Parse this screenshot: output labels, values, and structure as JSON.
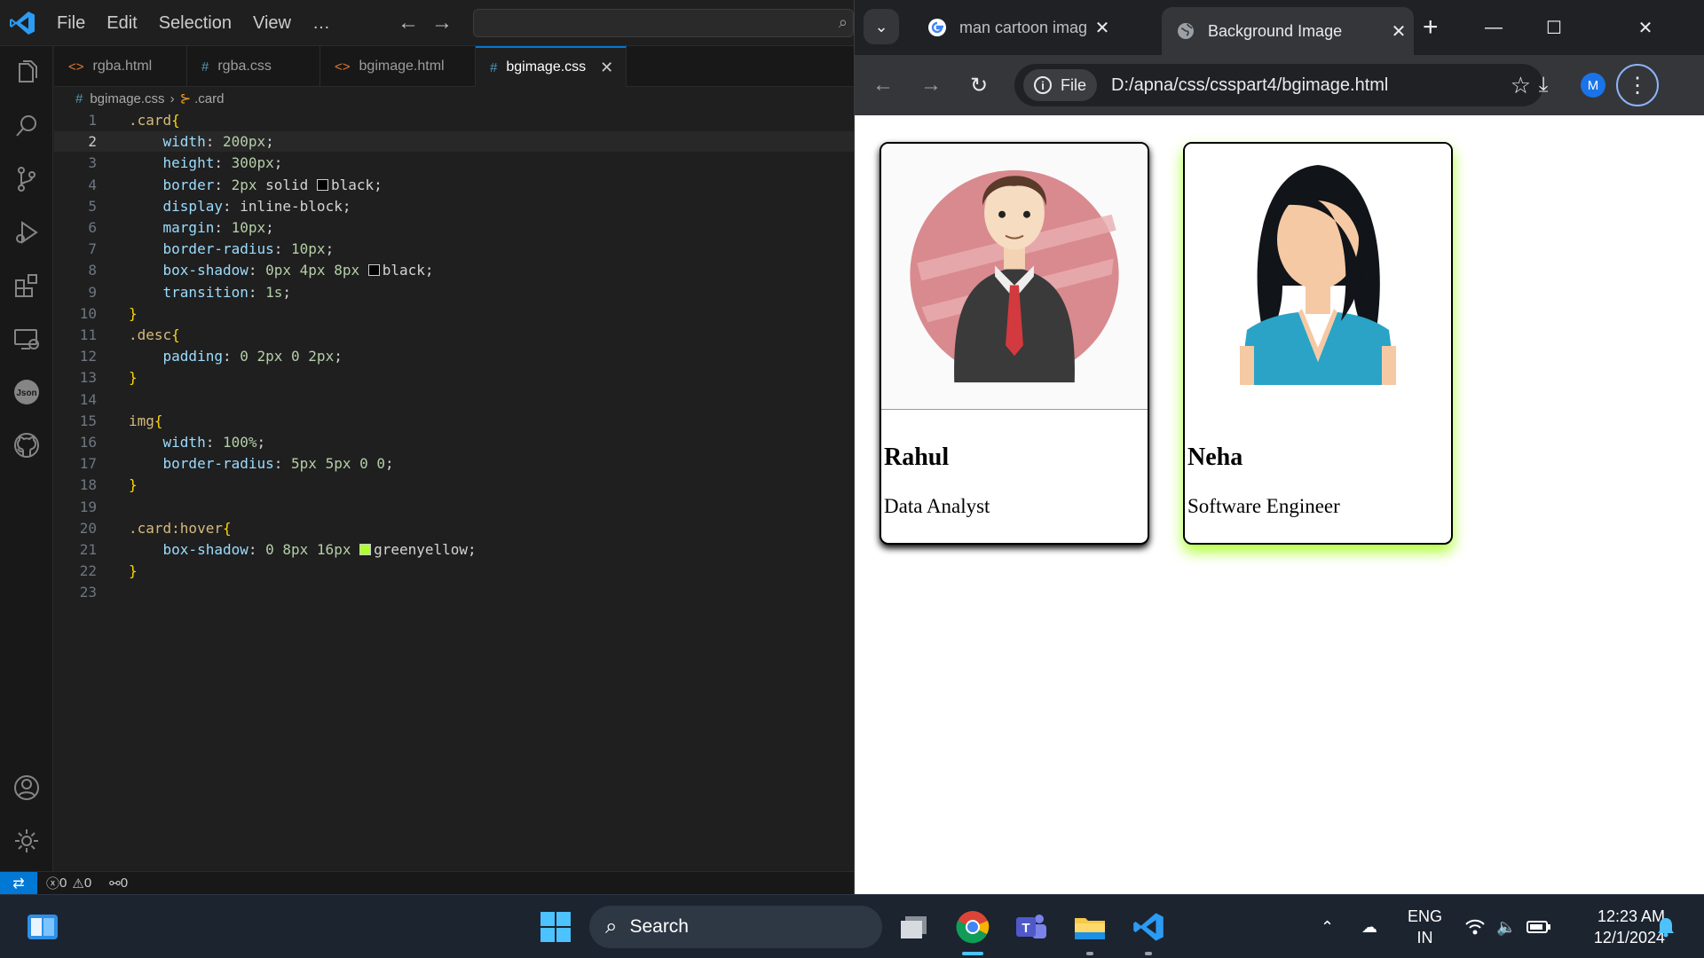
{
  "vscode": {
    "menu": [
      "File",
      "Edit",
      "Selection",
      "View",
      "…"
    ],
    "tabs": [
      {
        "label": "rgba.html",
        "icon": "<>",
        "kind": "html"
      },
      {
        "label": "rgba.css",
        "icon": "#",
        "kind": "css"
      },
      {
        "label": "bgimage.html",
        "icon": "<>",
        "kind": "html"
      },
      {
        "label": "bgimage.css",
        "icon": "#",
        "kind": "css",
        "active": true
      }
    ],
    "breadcrumb": {
      "file": "bgimage.css",
      "symbol": ".card"
    },
    "current_line": 2,
    "lines": [
      {
        "n": "1",
        "tokens": [
          [
            "sel",
            ".card"
          ],
          [
            "brace",
            "{"
          ]
        ]
      },
      {
        "n": "2",
        "tokens": [
          [
            "kw",
            "    "
          ],
          [
            "prop",
            "width"
          ],
          [
            "kw",
            ": "
          ],
          [
            "num",
            "200px"
          ],
          [
            "kw",
            ";"
          ]
        ]
      },
      {
        "n": "3",
        "tokens": [
          [
            "kw",
            "    "
          ],
          [
            "prop",
            "height"
          ],
          [
            "kw",
            ": "
          ],
          [
            "num",
            "300px"
          ],
          [
            "kw",
            ";"
          ]
        ]
      },
      {
        "n": "4",
        "tokens": [
          [
            "kw",
            "    "
          ],
          [
            "prop",
            "border"
          ],
          [
            "kw",
            ": "
          ],
          [
            "num",
            "2px"
          ],
          [
            "kw",
            " solid "
          ],
          [
            "swatch",
            "#000000"
          ],
          [
            "kw",
            "black;"
          ]
        ]
      },
      {
        "n": "5",
        "tokens": [
          [
            "kw",
            "    "
          ],
          [
            "prop",
            "display"
          ],
          [
            "kw",
            ": inline-block;"
          ]
        ]
      },
      {
        "n": "6",
        "tokens": [
          [
            "kw",
            "    "
          ],
          [
            "prop",
            "margin"
          ],
          [
            "kw",
            ": "
          ],
          [
            "num",
            "10px"
          ],
          [
            "kw",
            ";"
          ]
        ]
      },
      {
        "n": "7",
        "tokens": [
          [
            "kw",
            "    "
          ],
          [
            "prop",
            "border-radius"
          ],
          [
            "kw",
            ": "
          ],
          [
            "num",
            "10px"
          ],
          [
            "kw",
            ";"
          ]
        ]
      },
      {
        "n": "8",
        "tokens": [
          [
            "kw",
            "    "
          ],
          [
            "prop",
            "box-shadow"
          ],
          [
            "kw",
            ": "
          ],
          [
            "num",
            "0px 4px 8px"
          ],
          [
            "kw",
            " "
          ],
          [
            "swatch",
            "#000000"
          ],
          [
            "kw",
            "black;"
          ]
        ]
      },
      {
        "n": "9",
        "tokens": [
          [
            "kw",
            "    "
          ],
          [
            "prop",
            "transition"
          ],
          [
            "kw",
            ": "
          ],
          [
            "num",
            "1s"
          ],
          [
            "kw",
            ";"
          ]
        ]
      },
      {
        "n": "10",
        "tokens": [
          [
            "brace",
            "}"
          ]
        ]
      },
      {
        "n": "11",
        "tokens": [
          [
            "sel",
            ".desc"
          ],
          [
            "brace",
            "{"
          ]
        ]
      },
      {
        "n": "12",
        "tokens": [
          [
            "kw",
            "    "
          ],
          [
            "prop",
            "padding"
          ],
          [
            "kw",
            ": "
          ],
          [
            "num",
            "0 2px 0 2px"
          ],
          [
            "kw",
            ";"
          ]
        ]
      },
      {
        "n": "13",
        "tokens": [
          [
            "brace",
            "}"
          ]
        ]
      },
      {
        "n": "14",
        "tokens": []
      },
      {
        "n": "15",
        "tokens": [
          [
            "sel",
            "img"
          ],
          [
            "brace",
            "{"
          ]
        ]
      },
      {
        "n": "16",
        "tokens": [
          [
            "kw",
            "    "
          ],
          [
            "prop",
            "width"
          ],
          [
            "kw",
            ": "
          ],
          [
            "num",
            "100%"
          ],
          [
            "kw",
            ";"
          ]
        ]
      },
      {
        "n": "17",
        "tokens": [
          [
            "kw",
            "    "
          ],
          [
            "prop",
            "border-radius"
          ],
          [
            "kw",
            ": "
          ],
          [
            "num",
            "5px 5px 0 0"
          ],
          [
            "kw",
            ";"
          ]
        ]
      },
      {
        "n": "18",
        "tokens": [
          [
            "brace",
            "}"
          ]
        ]
      },
      {
        "n": "19",
        "tokens": []
      },
      {
        "n": "20",
        "tokens": [
          [
            "sel",
            ".card:hover"
          ],
          [
            "brace",
            "{"
          ]
        ]
      },
      {
        "n": "21",
        "tokens": [
          [
            "kw",
            "    "
          ],
          [
            "prop",
            "box-shadow"
          ],
          [
            "kw",
            ": "
          ],
          [
            "num",
            "0 8px 16px"
          ],
          [
            "kw",
            " "
          ],
          [
            "swatch",
            "#adff2f"
          ],
          [
            "kw",
            "greenyellow;"
          ]
        ]
      },
      {
        "n": "22",
        "tokens": [
          [
            "brace",
            "}"
          ]
        ]
      },
      {
        "n": "23",
        "tokens": []
      }
    ],
    "status": {
      "errors": "0",
      "warnings": "0",
      "ports": "0"
    }
  },
  "chrome": {
    "tabs": [
      {
        "title": "man cartoon image ha",
        "favicon": "google-icon"
      },
      {
        "title": "Background Image",
        "favicon": "globe-icon",
        "active": true
      }
    ],
    "omnibox": {
      "chip": "File",
      "url": "D:/apna/css/csspart4/bgimage.html"
    },
    "avatar_letter": "M",
    "cards": [
      {
        "name": "Rahul",
        "role": "Data Analyst"
      },
      {
        "name": "Neha",
        "role": "Software Engineer"
      }
    ]
  },
  "taskbar": {
    "search_label": "Search",
    "lang_line1": "ENG",
    "lang_line2": "IN",
    "time": "12:23 AM",
    "date": "12/1/2024"
  },
  "colors": {
    "accent": "#0078d4",
    "hover_glow": "#adff2f",
    "chrome_dark": "#202124"
  }
}
